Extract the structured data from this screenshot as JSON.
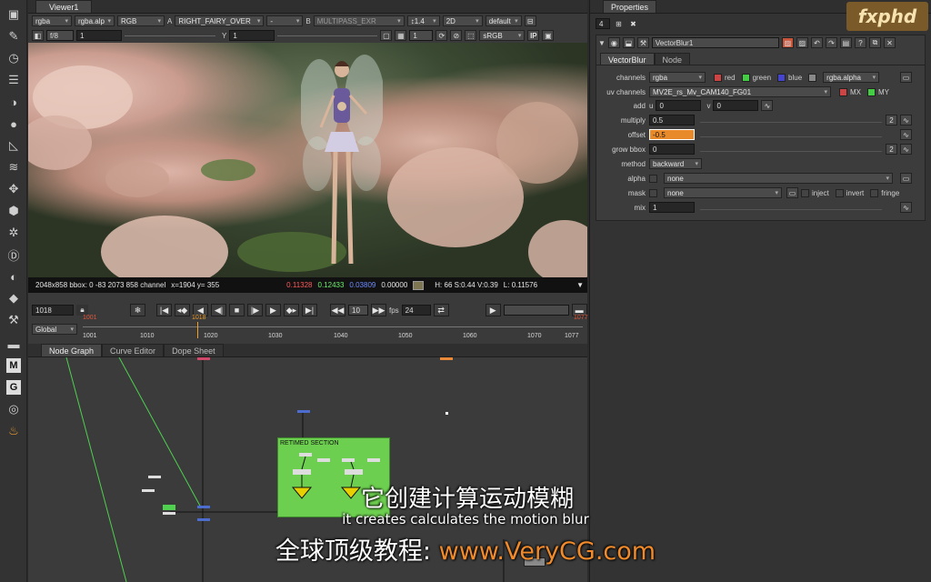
{
  "toolbar": {
    "icons": [
      "viewer-menu-icon",
      "paint-icon",
      "clock-icon",
      "channel-icon",
      "color-icon",
      "circle-icon",
      "filter-icon",
      "layers-icon",
      "transform-icon",
      "cube-icon",
      "particles-icon",
      "d-icon",
      "keyer-icon",
      "merge-icon",
      "toolsets-icon",
      "other-icon",
      "m-icon",
      "g-icon",
      "ball-icon",
      "furnace-icon"
    ],
    "m_label": "M",
    "g_label": "G"
  },
  "viewer": {
    "tab": "Viewer1",
    "row1": {
      "channels": "rgba",
      "layer": "rgba.alp",
      "display": "RGB",
      "a_label": "A",
      "a_input": "RIGHT_FAIRY_OVER",
      "a_op": "-",
      "b_label": "B",
      "b_input": "MULTIPASS_EXR",
      "zoom": "↕1.4",
      "mode": "2D",
      "lut": "default"
    },
    "row2": {
      "fstop": "f/8",
      "gain": "1",
      "y_label": "Y",
      "gamma": "1",
      "frame": "1",
      "colorspace": "sRGB",
      "ip": "IP"
    },
    "info": {
      "res": "2048x858 bbox: 0 -83 2073 858 channel",
      "xy": "x=1904 y= 355",
      "r": "0.11328",
      "g": "0.12433",
      "b": "0.03809",
      "a": "0.00000",
      "hsv": "H: 66 S:0.44 V:0.39",
      "l": "L: 0.11576"
    },
    "timeline": {
      "frame": "1018",
      "sync": "Global",
      "step": "10",
      "fps_label": "fps",
      "fps": "24",
      "in": "1001",
      "out": "1077",
      "cur": "1018",
      "ticks": [
        "1001",
        "1010",
        "1020",
        "1030",
        "1040",
        "1050",
        "1060",
        "1070",
        "1077"
      ]
    }
  },
  "nodegraph": {
    "tabs": [
      "Node Graph",
      "Curve Editor",
      "Dope Sheet"
    ],
    "backdrop_label": "RETIMED SECTION"
  },
  "properties": {
    "tab": "Properties",
    "count": "4",
    "node_name": "VectorBlur1",
    "tabs": [
      "VectorBlur",
      "Node"
    ],
    "channels_label": "channels",
    "channels": "rgba",
    "red": "red",
    "green": "green",
    "blue": "blue",
    "alpha_ch": "rgba.alpha",
    "uv_label": "uv channels",
    "uv": "MV2E_rs_Mv_CAM140_FG01",
    "mx": "MX",
    "my": "MY",
    "add_label": "add",
    "u_label": "u",
    "u": "0",
    "v_label": "v",
    "v": "0",
    "multiply_label": "multiply",
    "multiply": "0.5",
    "offset_label": "offset",
    "offset": "-0.5",
    "grow_label": "grow bbox",
    "grow": "0",
    "method_label": "method",
    "method": "backward",
    "alpha_label": "alpha",
    "alpha": "none",
    "mask_label": "mask",
    "mask": "none",
    "inject": "inject",
    "invert": "invert",
    "fringe": "fringe",
    "mix_label": "mix",
    "mix": "1",
    "two": "2"
  },
  "watermark": "fxphd",
  "subtitles": {
    "zh": "它创建计算运动模糊",
    "en": "it creates calculates the motion blur",
    "promo_prefix": "全球顶级教程:",
    "promo_url": "www.VeryCG.com"
  },
  "colors": {
    "backdrop": "#6ccf4f",
    "accent": "#f08a2a",
    "panel": "#3c3c3c"
  }
}
